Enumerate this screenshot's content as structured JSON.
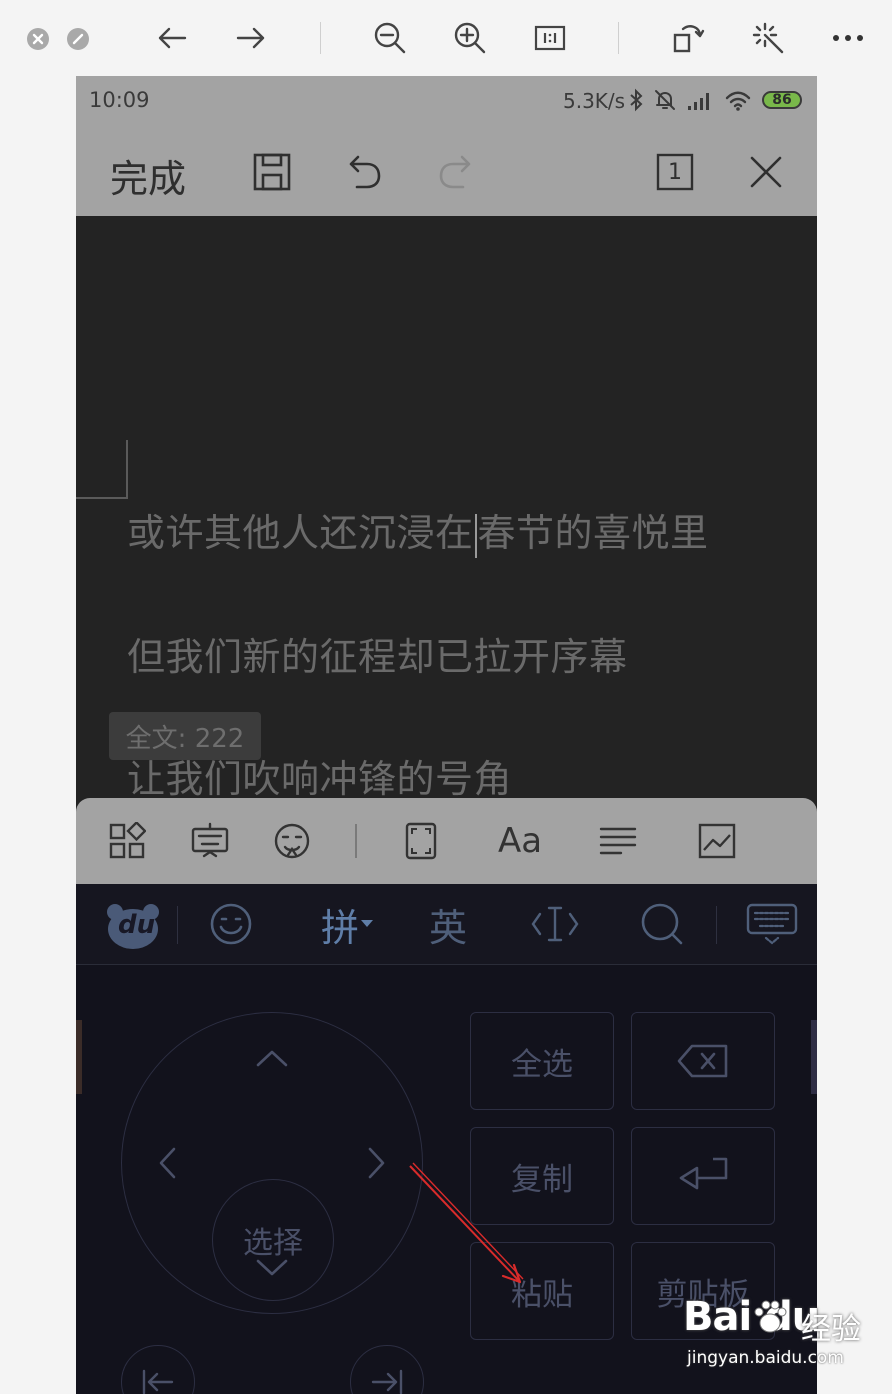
{
  "status_bar": {
    "time": "10:09",
    "net_speed": "5.3K/s",
    "battery_level": "86"
  },
  "app_bar": {
    "done_label": "完成",
    "page_badge": "1"
  },
  "document": {
    "lines": [
      "或许其他人还沉浸在",
      "春节的喜悦里",
      "但我们新的征程却已拉开序幕",
      "让我们吹响冲锋的号角"
    ],
    "word_count": "全文: 222"
  },
  "format_bar": {
    "font_label": "Aa"
  },
  "ime_bar": {
    "logo_text": "du",
    "pinyin_label": "拼",
    "english_label": "英"
  },
  "keyboard": {
    "select_label": "选择",
    "select_all_label": "全选",
    "copy_label": "复制",
    "paste_label": "粘贴",
    "clipboard_label": "剪贴板"
  },
  "watermark": {
    "brand": "Bai du",
    "brand_cn": "经验",
    "url": "jingyan.baidu.com"
  },
  "colors": {
    "annotation_arrow": "#d92b2b",
    "battery": "#79b84a",
    "ime_accent": "#4f5f7a"
  }
}
